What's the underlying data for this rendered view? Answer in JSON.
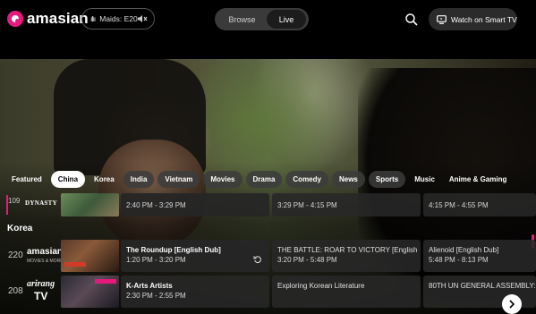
{
  "header": {
    "logo_text": "amasian",
    "audio_pill_label": "Maids: E20",
    "toggle": {
      "browse": "Browse",
      "live": "Live",
      "selected": "Live"
    },
    "smart_tv_label": "Watch on Smart TV"
  },
  "colors": {
    "brand": "#e8197d",
    "background": "#000000",
    "chip_active": "#ffffff"
  },
  "icons": [
    "audio-wave-icon",
    "mute-icon",
    "search-icon",
    "tv-icon",
    "replay-icon",
    "chevron-right-icon"
  ],
  "categories": {
    "items": [
      "Featured",
      "China",
      "Korea",
      "India",
      "Vietnam",
      "Movies",
      "Drama",
      "Comedy",
      "News",
      "Sports",
      "Music",
      "Anime & Gaming"
    ],
    "selected": "China"
  },
  "guide": {
    "partial_row": {
      "channel_logo": "DYNASTY",
      "channel_number": "109",
      "programs": [
        {
          "time": "2:40 PM - 3:29 PM"
        },
        {
          "time": "3:29 PM - 4:15 PM"
        },
        {
          "time": "4:15 PM - 4:55 PM"
        }
      ]
    },
    "section_title": "Korea",
    "rows": [
      {
        "channel_number": "220",
        "channel_logo": "amasian tv",
        "channel_logo_sub": "MOVIES & MORE",
        "programs": [
          {
            "title": "The Roundup [English Dub]",
            "time": "1:20 PM - 3:20 PM"
          },
          {
            "title": "THE BATTLE: ROAR TO VICTORY [English",
            "time": "3:20 PM - 5:48 PM"
          },
          {
            "title": "Alienoid [English Dub]",
            "time": "5:48 PM - 8:13 PM"
          }
        ]
      },
      {
        "channel_number": "208",
        "channel_logo": "arirang",
        "channel_logo_sub": "TV",
        "programs": [
          {
            "title": "K-Arts Artists",
            "time": "2:30 PM - 2:55 PM"
          },
          {
            "title": "Exploring Korean Literature",
            "time": ""
          },
          {
            "title": "80TH UN GENERAL ASSEMBLY:",
            "time": ""
          }
        ]
      }
    ]
  }
}
